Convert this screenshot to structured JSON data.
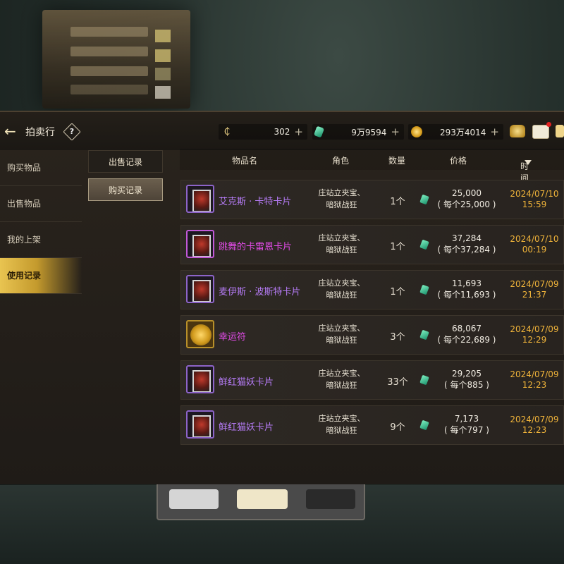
{
  "header": {
    "title": "拍卖行",
    "help": "?",
    "currency": [
      {
        "icon": "coupon-icon",
        "value": "302",
        "color": "#d9c07a"
      },
      {
        "icon": "gem-icon",
        "value": "9万9594",
        "color": "#2fcf94"
      },
      {
        "icon": "gold-coin-icon",
        "value": "293万4014",
        "color": "#e4b43a"
      }
    ]
  },
  "sidebar": {
    "items": [
      {
        "label": "购买物品"
      },
      {
        "label": "出售物品"
      },
      {
        "label": "我的上架"
      },
      {
        "label": "使用记录"
      }
    ]
  },
  "subtabs": {
    "sell_record": "出售记录",
    "buy_record": "购买记录"
  },
  "table": {
    "headers": {
      "item": "物品名",
      "role": "角色",
      "qty": "数量",
      "price": "价格",
      "time": "时间"
    },
    "rows": [
      {
        "name": "艾克斯 · 卡特卡片",
        "name_color": "#b57bf5",
        "icon": "card-icon",
        "role1": "庄站立夹宝、",
        "role2": "暗狱战狂",
        "qty": "1个",
        "price": "25,000",
        "unit": "( 每个25,000 )",
        "date": "2024/07/10",
        "time": "15:59"
      },
      {
        "name": "跳舞的卡雷恩卡片",
        "name_color": "#e24be8",
        "icon": "card-icon",
        "role1": "庄站立夹宝、",
        "role2": "暗狱战狂",
        "qty": "1个",
        "price": "37,284",
        "unit": "( 每个37,284 )",
        "date": "2024/07/10",
        "time": "00:19"
      },
      {
        "name": "麦伊斯 · 波斯特卡片",
        "name_color": "#b57bf5",
        "icon": "card-icon",
        "role1": "庄站立夹宝、",
        "role2": "暗狱战狂",
        "qty": "1个",
        "price": "11,693",
        "unit": "( 每个11,693 )",
        "date": "2024/07/09",
        "time": "21:37"
      },
      {
        "name": "幸运符",
        "name_color": "#e24be8",
        "icon": "charm-icon",
        "role1": "庄站立夹宝、",
        "role2": "暗狱战狂",
        "qty": "3个",
        "price": "68,067",
        "unit": "( 每个22,689 )",
        "date": "2024/07/09",
        "time": "12:29"
      },
      {
        "name": "鲜红猫妖卡片",
        "name_color": "#b57bf5",
        "icon": "card-icon",
        "role1": "庄站立夹宝、",
        "role2": "暗狱战狂",
        "qty": "33个",
        "price": "29,205",
        "unit": "( 每个885 )",
        "date": "2024/07/09",
        "time": "12:23"
      },
      {
        "name": "鲜红猫妖卡片",
        "name_color": "#b57bf5",
        "icon": "card-icon",
        "role1": "庄站立夹宝、",
        "role2": "暗狱战狂",
        "qty": "9个",
        "price": "7,173",
        "unit": "( 每个797 )",
        "date": "2024/07/09",
        "time": "12:23"
      }
    ]
  }
}
